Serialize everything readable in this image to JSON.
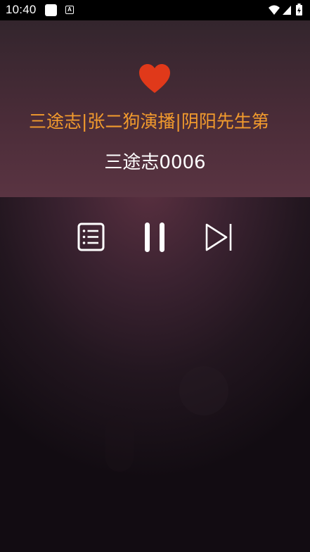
{
  "status_bar": {
    "time": "10:40",
    "icons": [
      "app-notification-icon",
      "a-icon",
      "wifi-icon",
      "signal-icon",
      "battery-charging-icon"
    ]
  },
  "player": {
    "favorite_icon": "heart-icon",
    "favorite_color": "#e0391a",
    "album_title": "三途志|张二狗演播|阴阳先生第",
    "album_title_color": "#f29b2d",
    "track_title": "三途志0006",
    "controls": {
      "playlist_icon": "playlist-icon",
      "pause_icon": "pause-icon",
      "next_icon": "skip-next-icon"
    }
  }
}
